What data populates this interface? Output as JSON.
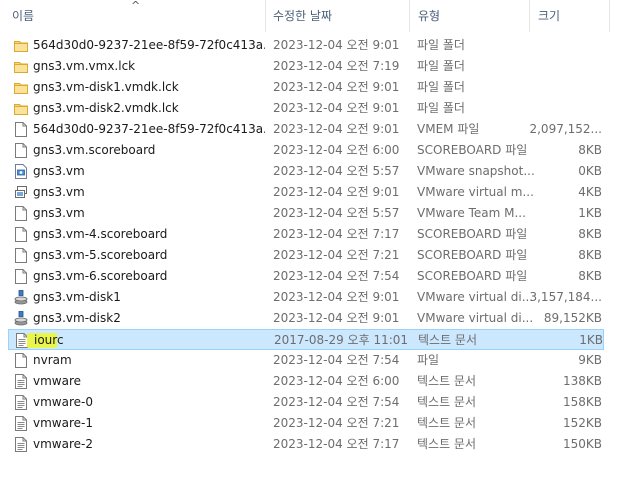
{
  "columns": {
    "name": "이름",
    "date": "수정한 날짜",
    "type": "유형",
    "size": "크기"
  },
  "rows": [
    {
      "name": "564d30d0-9237-21ee-8f59-72f0c413a...",
      "date": "2023-12-04 오전 9:01",
      "type": "파일 폴더",
      "size": "",
      "icon": "folder-icon"
    },
    {
      "name": "gns3.vm.vmx.lck",
      "date": "2023-12-04 오전 7:19",
      "type": "파일 폴더",
      "size": "",
      "icon": "folder-icon"
    },
    {
      "name": "gns3.vm-disk1.vmdk.lck",
      "date": "2023-12-04 오전 9:01",
      "type": "파일 폴더",
      "size": "",
      "icon": "folder-icon"
    },
    {
      "name": "gns3.vm-disk2.vmdk.lck",
      "date": "2023-12-04 오전 9:01",
      "type": "파일 폴더",
      "size": "",
      "icon": "folder-icon"
    },
    {
      "name": "564d30d0-9237-21ee-8f59-72f0c413a...",
      "date": "2023-12-04 오전 9:01",
      "type": "VMEM 파일",
      "size": "2,097,152...",
      "icon": "file-icon"
    },
    {
      "name": "gns3.vm.scoreboard",
      "date": "2023-12-04 오전 6:00",
      "type": "SCOREBOARD 파일",
      "size": "8KB",
      "icon": "file-icon"
    },
    {
      "name": "gns3.vm",
      "date": "2023-12-04 오전 5:57",
      "type": "VMware snapshot...",
      "size": "0KB",
      "icon": "vmware-snapshot-icon"
    },
    {
      "name": "gns3.vm",
      "date": "2023-12-04 오전 9:01",
      "type": "VMware virtual m...",
      "size": "4KB",
      "icon": "vmware-vm-icon"
    },
    {
      "name": "gns3.vm",
      "date": "2023-12-04 오전 5:57",
      "type": "VMware Team M...",
      "size": "1KB",
      "icon": "file-icon"
    },
    {
      "name": "gns3.vm-4.scoreboard",
      "date": "2023-12-04 오전 7:17",
      "type": "SCOREBOARD 파일",
      "size": "8KB",
      "icon": "file-icon"
    },
    {
      "name": "gns3.vm-5.scoreboard",
      "date": "2023-12-04 오전 7:21",
      "type": "SCOREBOARD 파일",
      "size": "8KB",
      "icon": "file-icon"
    },
    {
      "name": "gns3.vm-6.scoreboard",
      "date": "2023-12-04 오전 7:54",
      "type": "SCOREBOARD 파일",
      "size": "8KB",
      "icon": "file-icon"
    },
    {
      "name": "gns3.vm-disk1",
      "date": "2023-12-04 오전 9:01",
      "type": "VMware virtual di...",
      "size": "3,157,184...",
      "icon": "vmware-disk-icon"
    },
    {
      "name": "gns3.vm-disk2",
      "date": "2023-12-04 오전 9:01",
      "type": "VMware virtual di...",
      "size": "89,152KB",
      "icon": "vmware-disk-icon"
    },
    {
      "name": "iourc",
      "date": "2017-08-29 오후 11:01",
      "type": "텍스트 문서",
      "size": "1KB",
      "icon": "text-document-icon",
      "selected": true
    },
    {
      "name": "nvram",
      "date": "2023-12-04 오전 7:54",
      "type": "파일",
      "size": "9KB",
      "icon": "file-icon"
    },
    {
      "name": "vmware",
      "date": "2023-12-04 오전 6:00",
      "type": "텍스트 문서",
      "size": "138KB",
      "icon": "text-document-icon"
    },
    {
      "name": "vmware-0",
      "date": "2023-12-04 오전 7:54",
      "type": "텍스트 문서",
      "size": "158KB",
      "icon": "text-document-icon"
    },
    {
      "name": "vmware-1",
      "date": "2023-12-04 오전 7:21",
      "type": "텍스트 문서",
      "size": "152KB",
      "icon": "text-document-icon"
    },
    {
      "name": "vmware-2",
      "date": "2023-12-04 오전 7:17",
      "type": "텍스트 문서",
      "size": "150KB",
      "icon": "text-document-icon"
    }
  ],
  "colors": {
    "selection_bg": "#cce8ff",
    "selection_border": "#99d1ff",
    "folder": "#f8d775",
    "highlight": "#e9f54a"
  }
}
